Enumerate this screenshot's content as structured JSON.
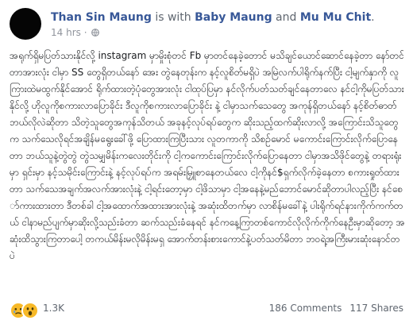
{
  "header": {
    "author": "Than Sin Maung",
    "with_text": " is with ",
    "tag1": "Baby Maung",
    "and_text": " and ",
    "tag2": "Mu Mu Chit",
    "period": ".",
    "time": "14 hrs",
    "separator": " · ",
    "privacy_icon": "globe-icon"
  },
  "post": {
    "text": "အရုက်ရှိမပြတ်သားနိုင်လို့ instagram မှာမှိုးစုံတင် Fb မှာတင်နေခဲ့တောင် မသိချင်ယောင်ဆောင်နေခဲ့တာ နော်တင်တာအားလုံး ငါမှာ SS တွေရှိတယ်နော် အေး တွဲနေတုန်းက နင့်လူစိတ်မရှိပဲ အမြဲလက်ပါရိုက်နက်ပြီး ငါ့မျက်နှာကို လူကြားထဲမထွက်နိုင်အောင် ရိုက်ထားတဲ့ပုံတွေအားလုံး ငါထုပ်ပြမှာ နင်လိုက်ပတ်သတ်ချင်နေတာလေ နင်ငါ့ကိုမပြတ်သားနိုင်လို့ ဟိုလူကိုစကားလာပြောခိုင်း ဒီလူကိုစကားလာပြောခိုင်း နဲ့ ငါမှာသက်သေတွေ အကုန်ရှိတယ်နော် နင့်စိတ်ဓာတ်ဘယ်လိုလဲဆိုတာ သိတဲ့သူတွေအကုန်သိတယ် အခုနင့်လုပ်ရပ်တွေက ဆိုးသည့်ထက်ဆိုးလာလို့ အကြောင်းသိသူတွေက သက်သေလိုရင်အချိန်မရွေးခေါ်ဖို့ ပြောထားကြပြီးသား လူတကာကို သိစဉ်မောင် မကောင်းကြောင်းလိုက်ပြောနေတာ ဘယ်သူနဲ့တွဲတွဲ တွဲသမျှမိန်းကလေးတိုင်းကို ငါ့ကကောင်းကြောင်းလိုက်ပြောနေတာ ငါမှာအသိဖိုင်တွေနဲ့ တရားရုံးမှာ ရှင်းမှာ နင့်သမိုင်းကြောင်းနဲ့ နင့်လုပ်ရပ်က အရမ်းမြှူစာနေတယ်လေ ငါ့ကိုနင်$ရှက်လိုက်ခဲ့နေတာ စကားရှုတ်ထားတာ သက်သေအချက်အလက်အားလုံးနဲ့ ငါ့ရင်းတော့မှာ ငါ့ဖိသာမှာ ငါ့အနေနဲ့မည်ဘောင်မောင်ဆိုတာပါလည့်ပြီး နင်စော်ကားထားတာ ဒီတစ်ခါ ငါ့အထောက်အထားအားလုံးနဲ့ အဆုံးထိတက်မှာ လာစိန်မခေါ်နဲ့ ပါးရိုက်ရင်နားကိုက်ကက်တယ် ငါနာမည်ပျက်မှာဆိုးလို့သည်းခံတာ ဆက်သည်းခံနေရင် နင်ကနေ့ကြာတစ်ကောင်လိုလိုက်ကိုက်နေဦးမှာဆိုတော့ အဆုံးထိသွားကြတာပေါ့ တကယ်မိန်းမလိုမိန်းမရှ အောက်တန်းစားကောင်နဲ့ပတ်သတ်မိတာ ဘဝရဲ့အကြီးမားဆုံးနောင်တပဲ"
  },
  "reactions": {
    "icon1": "sad-face-icon",
    "icon2": "wow-face-icon",
    "count": "1.3K",
    "comments": "186 Comments",
    "shares": "117 Shares"
  }
}
